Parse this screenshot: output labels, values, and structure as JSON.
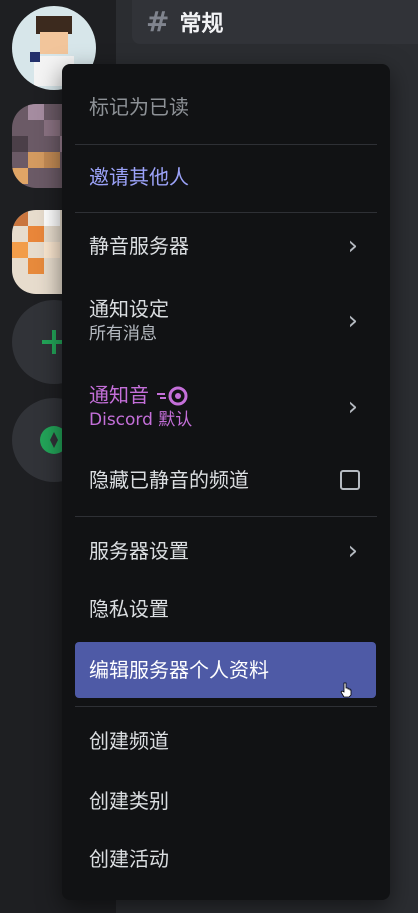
{
  "header": {
    "hash_symbol": "#",
    "channel_name": "常规"
  },
  "menu": {
    "mark_read": "标记为已读",
    "invite": "邀请其他人",
    "mute_server": "静音服务器",
    "notification_settings": "通知设定",
    "notification_settings_value": "所有消息",
    "notification_sound": "通知音",
    "notification_sound_value": "Discord 默认",
    "hide_muted_channels": "隐藏已静音的频道",
    "server_settings": "服务器设置",
    "privacy_settings": "隐私设置",
    "edit_server_profile": "编辑服务器个人资料",
    "create_channel": "创建频道",
    "create_category": "创建类别",
    "create_event": "创建活动"
  },
  "colors": {
    "invite": "#9ba2f8",
    "nitro": "#c46fd9",
    "highlight": "#4e5aa6",
    "add_green": "#23a559"
  }
}
